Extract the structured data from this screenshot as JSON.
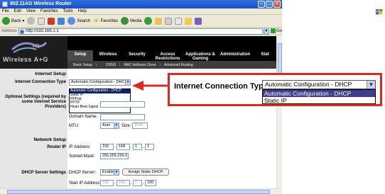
{
  "window": {
    "title": "802.11AG Wireless Router"
  },
  "menu": [
    "File",
    "Edit",
    "View",
    "Favorites",
    "Tools",
    "Help"
  ],
  "toolbar": {
    "back": "Back",
    "search": "Search",
    "favorites": "Favorites",
    "media": "Media"
  },
  "address": {
    "label": "Address",
    "url": "http://192.168.1.1",
    "go": "Go"
  },
  "router": {
    "brand": "Wireless A+G",
    "tabs": [
      "Setup",
      "Wireless",
      "Security",
      "Access Restrictions",
      "Applications & Gaming",
      "Administration",
      "Stat"
    ],
    "subtabs": [
      "Basic Setup",
      "DDNS",
      "MAC Address Clone",
      "Advanced Routing"
    ]
  },
  "setup": {
    "internet_setup": "Internet Setup",
    "connection_type_label": "Internet Connection Type",
    "connection_value": "Automatic Configuration - DHCP",
    "options": [
      "Automatic Configuration - DHCP",
      "Static IP",
      "PPPoE",
      "PPTP",
      "Heart Beat Signal"
    ],
    "optional_settings": "Optional Settings (required by some internet Service Providers)",
    "router_name_label": "Router Name:",
    "host_name_label": "Host Name:",
    "domain_name_label": "Domain Name:",
    "mtu_label": "MTU:",
    "mtu_mode": "Auto",
    "size_label": "Size:",
    "size_value": "1500"
  },
  "network": {
    "title": "Network Setup",
    "router_ip": "Router IP",
    "ip_address_label": "IP Address:",
    "ip": [
      "192",
      "168",
      "1",
      "1"
    ],
    "subnet_label": "Subnet Mask:",
    "subnet_value": "255.255.255.0"
  },
  "dhcp": {
    "title": "DHCP Server Settings",
    "server_label": "DHCP Server:",
    "server_value": "Enable",
    "assign_button": "Assign Static DHCP",
    "start_label": "Start IP Address:",
    "start_ip": [
      "192",
      "168",
      "1",
      "100"
    ]
  },
  "callout": {
    "label": "Internet Connection Type",
    "selected": "Automatic Configuration - DHCP",
    "list": [
      "Automatic Configuration - DHCP",
      "Static IP"
    ],
    "arrow_color": "#d92a1f"
  }
}
